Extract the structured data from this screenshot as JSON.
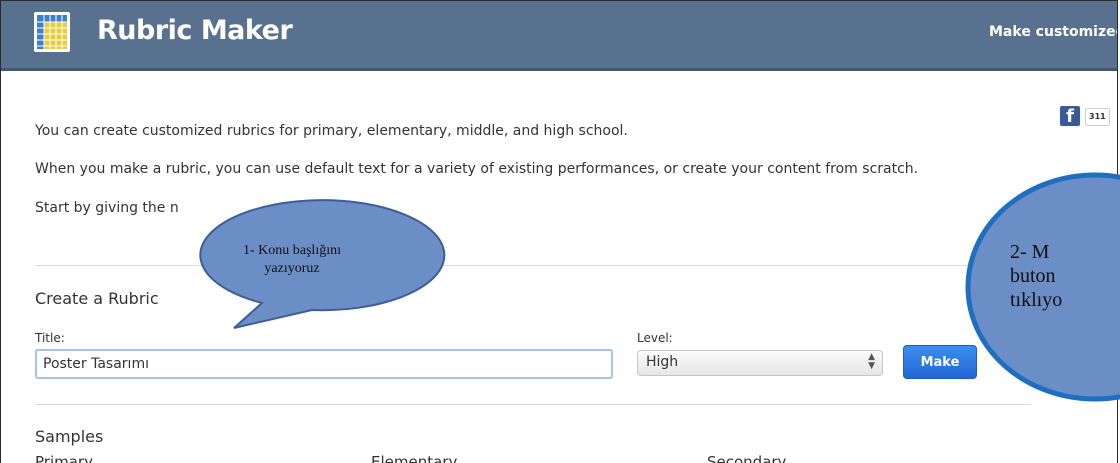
{
  "header": {
    "app_title": "Rubric Maker",
    "tagline": "Make customized"
  },
  "social": {
    "facebook_icon": "f",
    "share_count": "311"
  },
  "intro": {
    "line1": "You can create customized rubrics for primary, elementary, middle, and high school.",
    "line2": "When you make a rubric, you can use default text for a variety of existing performances, or create your content from scratch.",
    "line3": "Start by giving the n"
  },
  "form": {
    "section_title": "Create a Rubric",
    "title_label": "Title:",
    "title_value": "Poster Tasarımı",
    "level_label": "Level:",
    "level_value": "High",
    "make_button": "Make"
  },
  "samples": {
    "section_title": "Samples",
    "columns": [
      "Primary",
      "Elementary",
      "Secondary"
    ]
  },
  "annotations": {
    "callout1": "1- Konu başlığını yazıyoruz",
    "callout2": "2- M\nbuton\ntıklıyo",
    "callout_fill": "#6b8ec7",
    "callout2_border": "#1f6fc0"
  },
  "colors": {
    "header_bg": "#58718e",
    "make_button": "#2d7ae6",
    "facebook": "#3b5998"
  }
}
